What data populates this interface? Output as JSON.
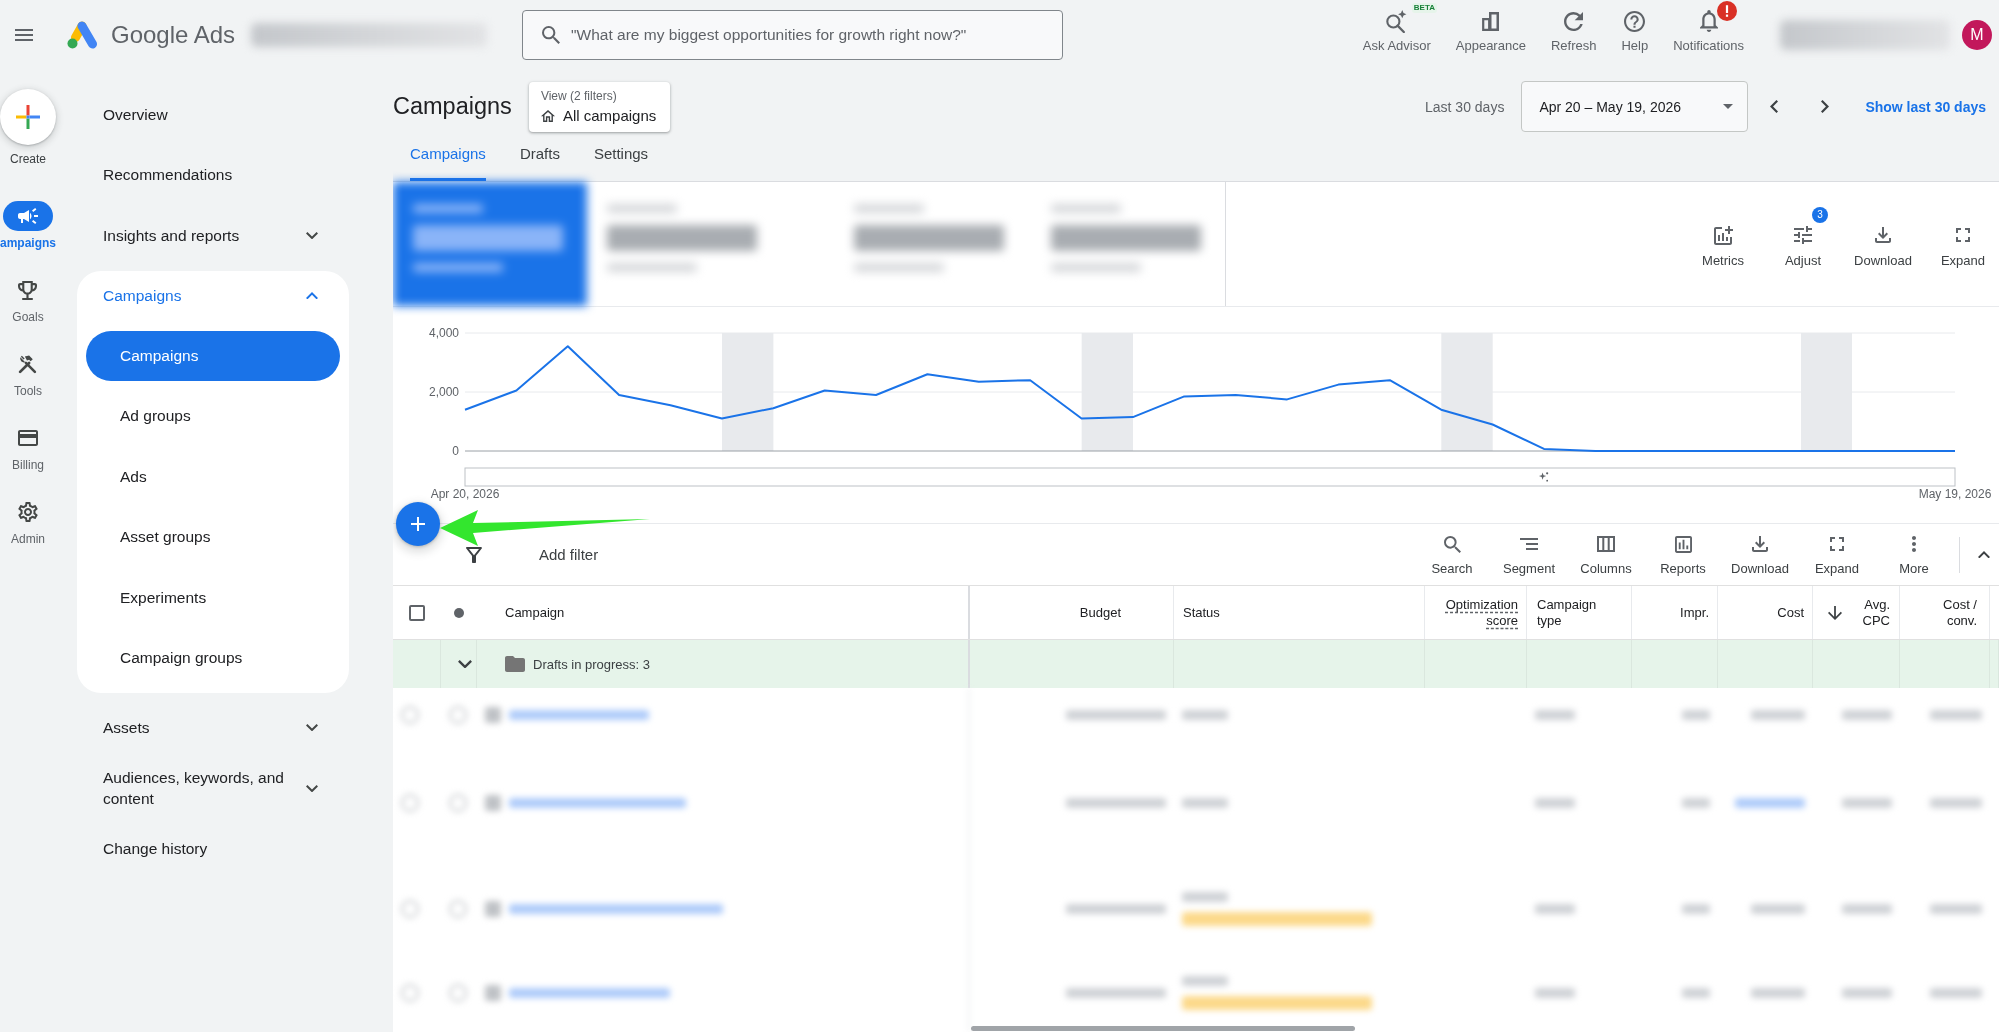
{
  "top_bar": {
    "product_name": "Google Ads",
    "search": {
      "placeholder": "\"What are my biggest opportunities for growth right now?\""
    },
    "actions": [
      {
        "label": "Ask Advisor",
        "kind": "advisor",
        "badge": "BETA",
        "alert": false
      },
      {
        "label": "Appearance",
        "kind": "appearance",
        "alert": false
      },
      {
        "label": "Refresh",
        "kind": "refresh",
        "alert": false
      },
      {
        "label": "Help",
        "kind": "help",
        "alert": false
      },
      {
        "label": "Notifications",
        "kind": "notifications",
        "alert": true
      }
    ],
    "avatar": {
      "initial": "M"
    }
  },
  "rail": {
    "create_label": "Create",
    "items": [
      {
        "label": "ampaigns",
        "kind": "megaphone",
        "selected": true
      },
      {
        "label": "Goals",
        "kind": "trophy",
        "selected": false
      },
      {
        "label": "Tools",
        "kind": "tools",
        "selected": false
      },
      {
        "label": "Billing",
        "kind": "card",
        "selected": false
      },
      {
        "label": "Admin",
        "kind": "gear",
        "selected": false
      }
    ]
  },
  "nav": {
    "items": [
      {
        "label": "Overview",
        "kind": "link",
        "selected": false
      },
      {
        "label": "Recommendations",
        "kind": "link",
        "selected": false
      },
      {
        "label": "Insights and reports",
        "kind": "group",
        "expanded": false
      },
      {
        "label": "Campaigns",
        "kind": "group",
        "expanded": true,
        "children": [
          {
            "label": "Campaigns",
            "selected": true
          },
          {
            "label": "Ad groups",
            "selected": false
          },
          {
            "label": "Ads",
            "selected": false
          },
          {
            "label": "Asset groups",
            "selected": false
          },
          {
            "label": "Experiments",
            "selected": false
          },
          {
            "label": "Campaign groups",
            "selected": false
          }
        ]
      },
      {
        "label": "Assets",
        "kind": "group",
        "expanded": false
      },
      {
        "label": "Audiences, keywords, and content",
        "kind": "group",
        "expanded": false
      },
      {
        "label": "Change history",
        "kind": "link",
        "selected": false
      }
    ]
  },
  "page_header": {
    "title": "Campaigns",
    "view": {
      "caption": "View (2 filters)",
      "value": "All campaigns"
    },
    "date_range": {
      "label": "Last 30 days",
      "value": "Apr 20 – May 19, 2026"
    },
    "link": "Show last 30 days"
  },
  "tabs": [
    {
      "label": "Campaigns",
      "selected": true
    },
    {
      "label": "Drafts",
      "selected": false
    },
    {
      "label": "Settings",
      "selected": false
    }
  ],
  "overview": {
    "scorecards": [
      {
        "selected": true
      },
      {
        "selected": false
      },
      {
        "selected": false
      },
      {
        "selected": false
      }
    ],
    "tools": [
      {
        "label": "Metrics",
        "kind": "metrics"
      },
      {
        "label": "Adjust",
        "kind": "adjust",
        "badge": "3"
      },
      {
        "label": "Download",
        "kind": "download"
      },
      {
        "label": "Expand",
        "kind": "expand"
      }
    ],
    "chart_data": {
      "type": "line",
      "categories": [
        "Apr 20, 2026",
        null,
        null,
        null,
        null,
        null,
        null,
        null,
        null,
        null,
        null,
        null,
        null,
        null,
        null,
        null,
        null,
        null,
        null,
        null,
        null,
        null,
        null,
        null,
        null,
        null,
        null,
        null,
        null,
        "May 19, 2026"
      ],
      "ylim": [
        0,
        4000
      ],
      "yticks": [
        {
          "value": 0,
          "label": "0"
        },
        {
          "value": 2000,
          "label": "2,000"
        },
        {
          "value": 4000,
          "label": "4,000"
        }
      ],
      "series": [
        {
          "color": "#1a73e8",
          "values": [
            1400,
            2050,
            3550,
            1900,
            1550,
            1100,
            1450,
            2050,
            1900,
            2600,
            2350,
            2400,
            1100,
            1150,
            1850,
            1900,
            1750,
            2250,
            2400,
            1400,
            900,
            70,
            0,
            0,
            0,
            0,
            0,
            0,
            0,
            0
          ]
        }
      ]
    }
  },
  "table": {
    "toolbar": {
      "filter_label": "Add filter",
      "tools": [
        {
          "label": "Search",
          "kind": "search"
        },
        {
          "label": "Segment",
          "kind": "segment"
        },
        {
          "label": "Columns",
          "kind": "columns"
        },
        {
          "label": "Reports",
          "kind": "reports"
        },
        {
          "label": "Download",
          "kind": "download"
        },
        {
          "label": "Expand",
          "kind": "expand"
        },
        {
          "label": "More",
          "kind": "more"
        }
      ]
    },
    "select_all": {
      "checked": false
    },
    "columns": [
      {
        "label": "Campaign",
        "kind": "text",
        "hint": false,
        "sorted": false
      },
      {
        "label": "Budget",
        "kind": "number",
        "hint": false,
        "sorted": false
      },
      {
        "label": "Status",
        "kind": "text",
        "hint": false,
        "sorted": false
      },
      {
        "label": "Optimization score",
        "kind": "number",
        "hint": true,
        "sorted": false
      },
      {
        "label": "Campaign type",
        "kind": "text",
        "hint": false,
        "sorted": false
      },
      {
        "label": "Impr.",
        "kind": "number",
        "hint": false,
        "sorted": false
      },
      {
        "label": "Cost",
        "kind": "number",
        "hint": false,
        "sorted": false
      },
      {
        "label": "Avg. CPC",
        "kind": "number",
        "hint": false,
        "sorted": true
      },
      {
        "label": "Cost / conv.",
        "kind": "number",
        "hint": false,
        "sorted": false
      }
    ],
    "draft_row": {
      "label": "Drafts in progress: 3",
      "expanded": false
    },
    "rows": [
      {
        "kind": "redacted",
        "warning": false
      },
      {
        "kind": "redacted",
        "warning": false
      },
      {
        "kind": "redacted",
        "warning": true
      },
      {
        "kind": "redacted",
        "warning": true
      }
    ]
  }
}
